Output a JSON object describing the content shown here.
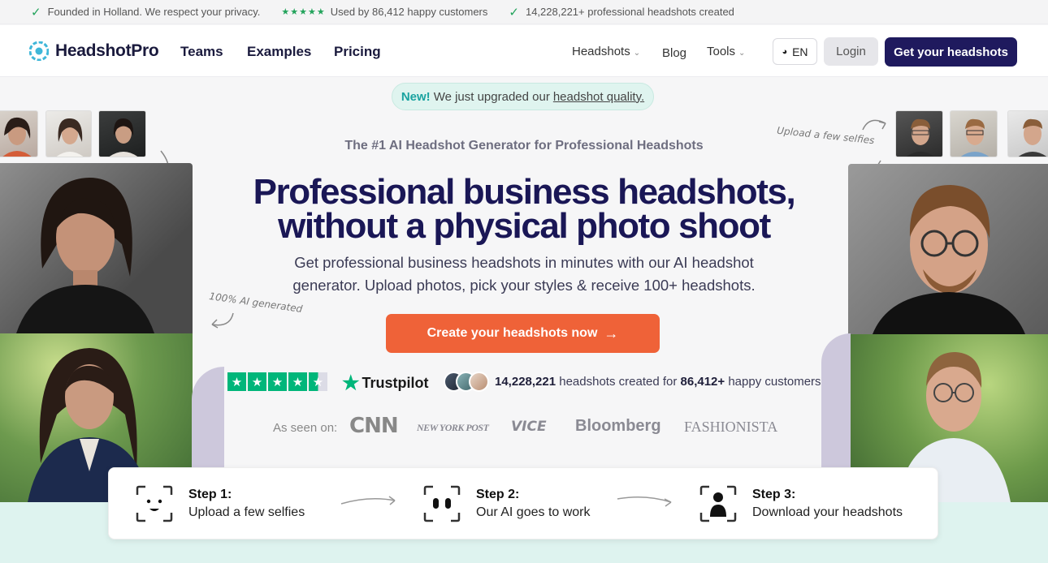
{
  "topbar": {
    "items": [
      {
        "text": "Founded in Holland. We respect your privacy."
      },
      {
        "text": "Used by 86,412 happy customers"
      },
      {
        "text": "14,228,221+ professional headshots created"
      }
    ],
    "rating_stars": "★★★★★"
  },
  "nav": {
    "brand": "HeadshotPro",
    "links": [
      "Teams",
      "Examples",
      "Pricing"
    ],
    "right_links": [
      "Headshots",
      "Blog",
      "Tools"
    ],
    "lang": "EN",
    "login": "Login",
    "cta": "Get your headshots"
  },
  "hero": {
    "badge_new": "New!",
    "badge_text": "We just upgraded our",
    "badge_link": "headshot quality.",
    "eyebrow": "The #1 AI Headshot Generator for Professional Headshots",
    "title_line1": "Professional business headshots,",
    "title_line2": "without a physical photo shoot",
    "subtitle_line1": "Get professional business headshots in minutes with our AI headshot",
    "subtitle_line2": "generator. Upload photos, pick your styles & receive 100+ headshots.",
    "cta": "Create your headshots now",
    "cta_arrow": "→",
    "annotation_left": "100% AI generated",
    "annotation_right": "Upload a few selfies"
  },
  "trust": {
    "trustpilot": "Trustpilot",
    "headshots_count": "14,228,221",
    "text_mid": "headshots created for",
    "customers_count": "86,412+",
    "text_end": "happy customers"
  },
  "press": {
    "label": "As seen on:",
    "logos": [
      "CNN",
      "NEW YORK POST",
      "VICE",
      "Bloomberg",
      "FASHIONISTA"
    ]
  },
  "steps": [
    {
      "title": "Step 1:",
      "text": "Upload a few selfies",
      "icon": "face-scan-icon"
    },
    {
      "title": "Step 2:",
      "text": "Our AI goes to work",
      "icon": "ai-eyes-icon"
    },
    {
      "title": "Step 3:",
      "text": "Download your headshots",
      "icon": "person-frame-icon"
    }
  ],
  "colors": {
    "brand": "#1f1a5e",
    "cta": "#ef6238",
    "trustpilot": "#00b67a",
    "check": "#22a35b"
  }
}
